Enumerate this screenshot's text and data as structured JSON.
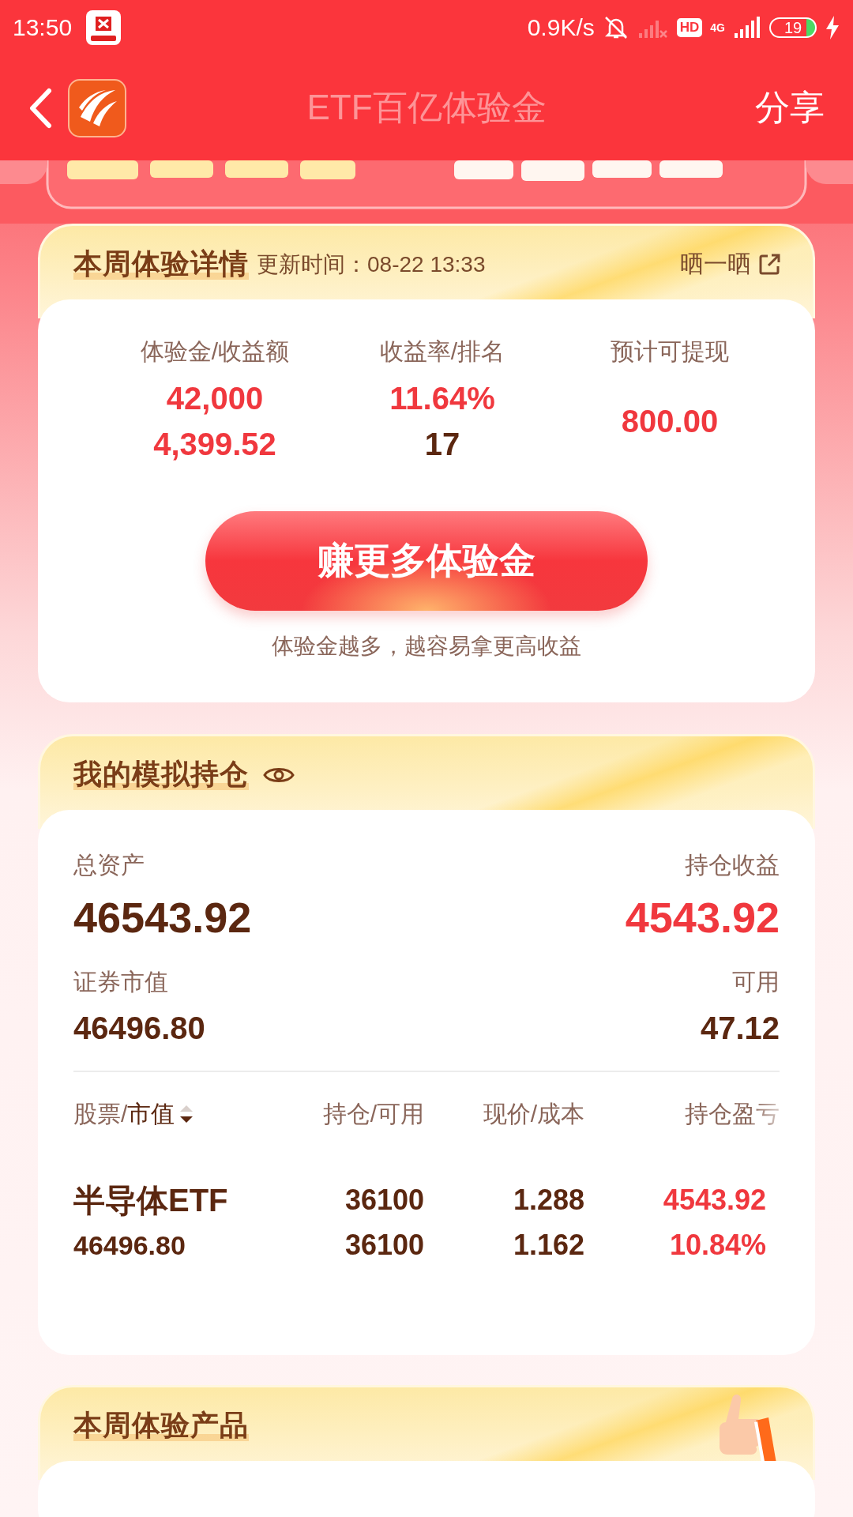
{
  "status_bar": {
    "time": "13:50",
    "speed": "0.9K/s",
    "hd": "HD",
    "network": "4G",
    "battery": "19"
  },
  "app_bar": {
    "title": "ETF百亿体验金",
    "action": "分享"
  },
  "detail_card": {
    "title": "本周体验详情",
    "update_time": "更新时间：08-22 13:33",
    "share_label": "晒一晒",
    "stats": [
      {
        "label": "体验金/收益额",
        "values": [
          {
            "text": "42,000",
            "kind": "gain"
          },
          {
            "text": "4,399.52",
            "kind": "gain"
          }
        ]
      },
      {
        "label": "收益率/排名",
        "values": [
          {
            "text": "11.64%",
            "kind": "gain"
          },
          {
            "text": "17",
            "kind": "plain"
          }
        ]
      },
      {
        "label": "预计可提现",
        "values": [
          {
            "text": "800.00",
            "kind": "gain"
          }
        ]
      }
    ],
    "button": "赚更多体验金",
    "hint": "体验金越多，越容易拿更高收益"
  },
  "holdings_card": {
    "title": "我的模拟持仓",
    "summary": [
      [
        {
          "label": "总资产",
          "value": "46543.92",
          "kind": "plain"
        },
        {
          "label": "持仓收益",
          "value": "4543.92",
          "kind": "gain"
        }
      ],
      [
        {
          "label": "证券市值",
          "value": "46496.80",
          "kind": "plain"
        },
        {
          "label": "可用",
          "value": "47.12",
          "kind": "plain"
        }
      ]
    ],
    "columns": [
      {
        "label": "股票/",
        "sort_label": "市值"
      },
      {
        "label": "持仓/可用"
      },
      {
        "label": "现价/成本"
      },
      {
        "label": "持仓盈亏"
      }
    ],
    "rows": [
      {
        "cells": [
          [
            {
              "text": "半导体ETF",
              "kind": "plain"
            },
            {
              "text": "46496.80",
              "kind": "plain"
            }
          ],
          [
            {
              "text": "36100",
              "kind": "plain"
            },
            {
              "text": "36100",
              "kind": "plain"
            }
          ],
          [
            {
              "text": "1.288",
              "kind": "plain"
            },
            {
              "text": "1.162",
              "kind": "plain"
            }
          ],
          [
            {
              "text": "4543.92",
              "kind": "gain"
            },
            {
              "text": "10.84%",
              "kind": "gain"
            }
          ]
        ]
      }
    ]
  },
  "products_card": {
    "title": "本周体验产品"
  }
}
